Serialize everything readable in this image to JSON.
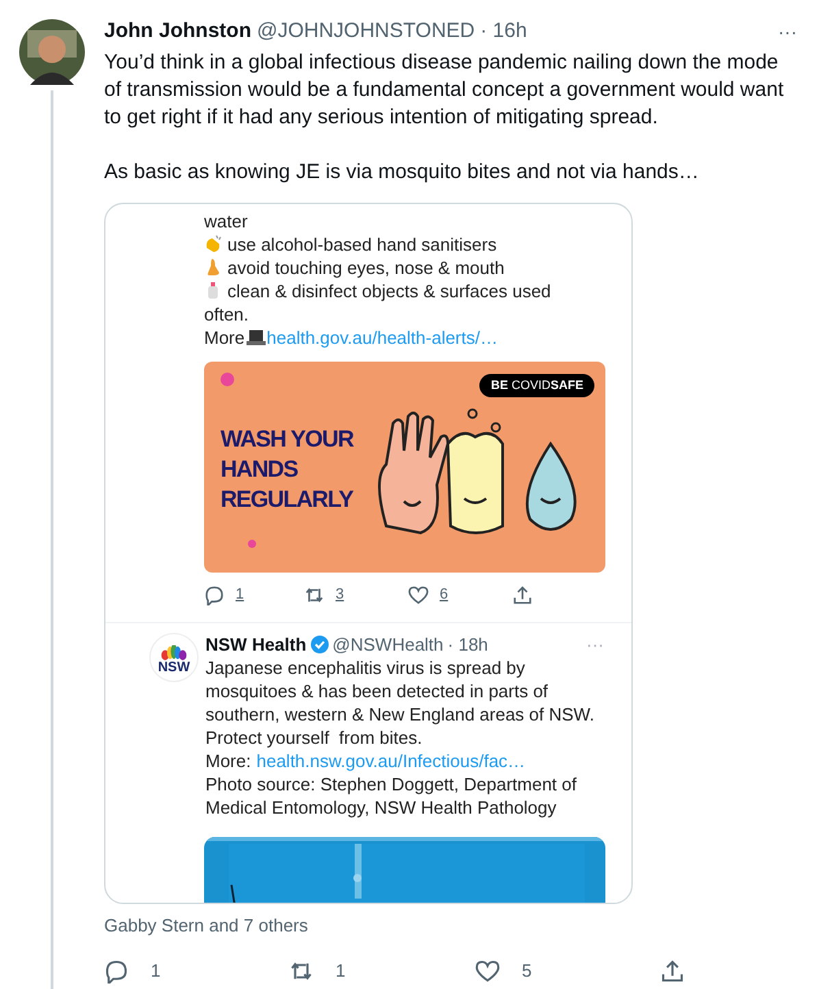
{
  "tweet": {
    "author": "John Johnston",
    "handle": "@JOHNJOHNSTONED",
    "time": "· 16h",
    "more": "···",
    "paragraphs": [
      "You’d think in a global infectious disease pandemic nailing down the mode of transmission would be a fundamental concept a government would want to get right if it had any serious intention of mitigating spread.",
      "As basic as knowing JE is via mosquito bites and not via hands…"
    ]
  },
  "screenshot": {
    "lines": [
      {
        "kind": "plain",
        "text": "water"
      },
      {
        "kind": "clap",
        "text": "use alcohol-based hand sanitisers"
      },
      {
        "kind": "nose",
        "text": "avoid touching eyes, nose & mouth"
      },
      {
        "kind": "bottle",
        "text": "clean & disinfect objects & surfaces used"
      },
      {
        "kind": "plain",
        "text": "often."
      }
    ],
    "more": {
      "label": "More",
      "link": "health.gov.au/health-alerts/…"
    },
    "poster": {
      "badge": "**BE** COVID**SAFE**",
      "headline": [
        "WASH YOUR",
        "HANDS",
        "REGULARLY"
      ]
    },
    "actions": [
      {
        "kind": "reply",
        "count": "1"
      },
      {
        "kind": "retweet",
        "count": "3"
      },
      {
        "kind": "like",
        "count": "6"
      },
      {
        "kind": "share"
      }
    ],
    "quoted": {
      "logo": "NSW",
      "author": "NSW Health",
      "verified": true,
      "handle": "@NSWHealth",
      "time": "· 18h",
      "more": "···",
      "lines": [
        "Japanese encephalitis virus is spread by",
        "mosquitoes & has been detected in parts of",
        "southern, western & New England areas of NSW.",
        "Protect yourself  from bites."
      ],
      "more_label": "More:",
      "link": "health.nsw.gov.au/Infectious/fac…",
      "source": [
        "Photo source: Stephen Doggett, Department of",
        "Medical Entomology, NSW Health Pathology"
      ]
    }
  },
  "likers": "Gabby Stern and 7 others",
  "actions": [
    {
      "kind": "reply",
      "count": "1"
    },
    {
      "kind": "retweet",
      "count": "1"
    },
    {
      "kind": "like",
      "count": "5"
    },
    {
      "kind": "share"
    }
  ]
}
